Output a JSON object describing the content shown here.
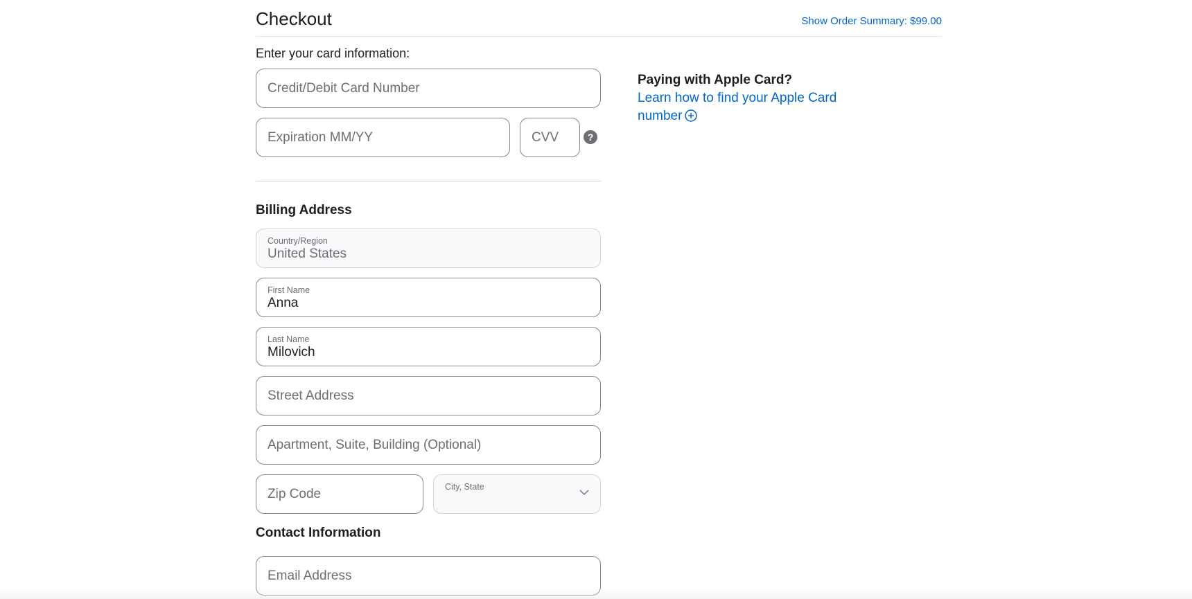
{
  "header": {
    "title": "Checkout",
    "order_summary_link": "Show Order Summary: $99.00"
  },
  "card": {
    "prompt": "Enter your card information:",
    "number_placeholder": "Credit/Debit Card Number",
    "expiration_placeholder": "Expiration MM/YY",
    "cvv_placeholder": "CVV",
    "cvv_help_glyph": "?"
  },
  "apple_card": {
    "heading": "Paying with Apple Card?",
    "link": "Learn how to find your Apple Card number",
    "link_icon": "plus-circle-icon"
  },
  "billing": {
    "heading": "Billing Address",
    "country_label": "Country/Region",
    "country_value": "United States",
    "first_name_label": "First Name",
    "first_name_value": "Anna",
    "last_name_label": "Last Name",
    "last_name_value": "Milovich",
    "street_placeholder": "Street Address",
    "apartment_placeholder": "Apartment, Suite, Building (Optional)",
    "zip_placeholder": "Zip Code",
    "city_state_label": "City, State",
    "city_state_value": ""
  },
  "contact": {
    "heading": "Contact Information",
    "email_placeholder": "Email Address"
  },
  "colors": {
    "link": "#0066cc",
    "text": "#1d1d1f",
    "border": "#86868b",
    "muted": "#6e6e73"
  }
}
